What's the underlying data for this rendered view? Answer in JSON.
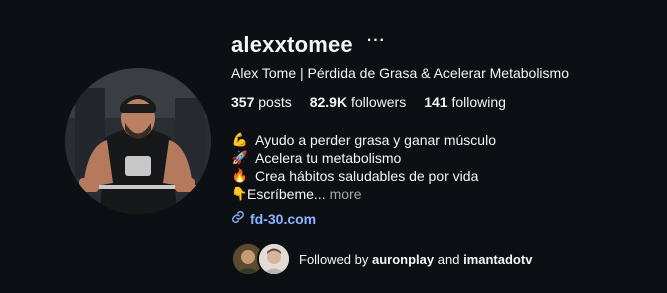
{
  "profile": {
    "username": "alexxtomee",
    "more_icon": "more-horizontal-icon",
    "full_name": "Alex Tome | Pérdida de Grasa & Acelerar Metabolismo",
    "stats": {
      "posts_value": "357",
      "posts_label": "posts",
      "followers_value": "82.9K",
      "followers_label": "followers",
      "following_value": "141",
      "following_label": "following"
    },
    "bio": [
      {
        "emoji": "💪",
        "text": "Ayudo a perder grasa y ganar músculo"
      },
      {
        "emoji": "🚀",
        "text": "Acelera tu metabolismo"
      },
      {
        "emoji": "🔥",
        "text": "Crea hábitos saludables de por vida"
      },
      {
        "emoji": "👇",
        "text": "Escríbeme..."
      }
    ],
    "bio_more": "more",
    "link_icon": "link-icon",
    "link_text": "fd-30.com",
    "followed_by": {
      "prefix": "Followed by",
      "user1": "auronplay",
      "conjunction": "and",
      "user2": "imantadotv"
    }
  },
  "colors": {
    "background": "#0c1014",
    "text": "#f5f5f5",
    "muted": "#a8a8a8",
    "link": "#8cb4ff"
  }
}
